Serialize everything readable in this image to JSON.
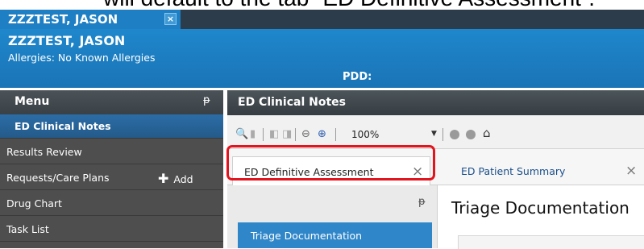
{
  "caption": "will default to the tab “ED Definitive Assessment”.",
  "patient_tab": {
    "name": "ZZZTEST, JASON",
    "close": "×"
  },
  "banner": {
    "name": "ZZZTEST, JASON",
    "allergies": "Allergies: No Known Allergies",
    "pdd": "PDD:"
  },
  "menu": {
    "title": "Menu",
    "pin": "ᵽ",
    "items": [
      {
        "label": "ED Clinical Notes",
        "active": true
      },
      {
        "label": "Results Review"
      },
      {
        "label": "Requests/Care Plans",
        "add_label": "Add"
      },
      {
        "label": "Drug Chart"
      },
      {
        "label": "Task List"
      }
    ]
  },
  "content": {
    "title": "ED Clinical Notes",
    "toolbar": {
      "zoom": "100%"
    },
    "tabs": [
      {
        "label": "ED Definitive Assessment",
        "close": "×"
      },
      {
        "label": "ED Patient Summary",
        "close": "×"
      }
    ],
    "side_panel": {
      "pin": "ᵽ",
      "button_label": "Triage Documentation"
    },
    "main_title": "Triage Documentation"
  },
  "colors": {
    "accent": "#1e7fc4",
    "highlight": "#e2141d",
    "menu_bg": "#4e4e4e"
  }
}
